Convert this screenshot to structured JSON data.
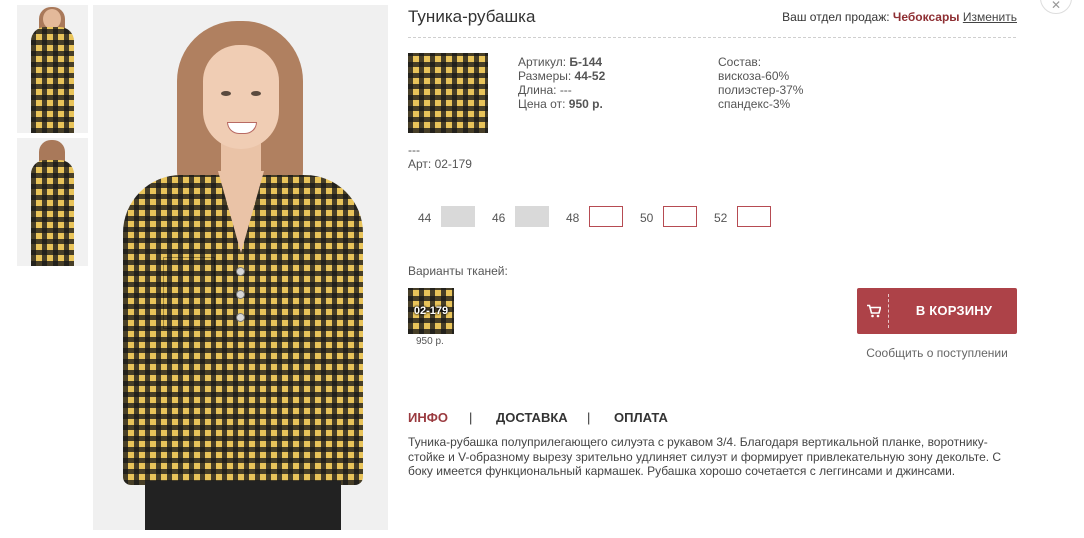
{
  "product": {
    "title": "Туника-рубашка",
    "fields": [
      {
        "label": "Артикул:",
        "value": "Б-144"
      },
      {
        "label": "Размеры:",
        "value": "44-52"
      },
      {
        "label": "Длина:",
        "value": "---"
      },
      {
        "label": "Цена от:",
        "value": "950 р."
      }
    ],
    "composition_title": "Состав:",
    "composition": [
      "вискоза-60%",
      "полиэстер-37%",
      "спандекс-3%"
    ],
    "dash": "---",
    "art_line": "Арт: 02-179"
  },
  "region": {
    "label": "Ваш отдел продаж:",
    "city": "Чебоксары",
    "change": "Изменить"
  },
  "sizes": [
    {
      "label": "44",
      "available": false
    },
    {
      "label": "46",
      "available": false
    },
    {
      "label": "48",
      "available": true
    },
    {
      "label": "50",
      "available": true
    },
    {
      "label": "52",
      "available": true
    }
  ],
  "variants": {
    "title": "Варианты тканей:",
    "items": [
      {
        "code": "02-179",
        "price": "950 р."
      }
    ]
  },
  "actions": {
    "cart_label": "В КОРЗИНУ",
    "notify_label": "Сообщить о поступлении"
  },
  "tabs": [
    {
      "label": "ИНФО",
      "active": true
    },
    {
      "label": "ДОСТАВКА",
      "active": false
    },
    {
      "label": "ОПЛАТА",
      "active": false
    }
  ],
  "tab_separator": "|",
  "description": "Туника-рубашка полуприлегающего силуэта с рукавом 3/4. Благодаря вертикальной планке, воротнику-стойке и V-образному вырезу зрительно удлиняет силуэт и формирует привлекательную зону декольте. С боку имеется функциональный кармашек. Рубашка хорошо сочетается с леггинсами и джинсами.",
  "colors": {
    "accent": "#ad4248",
    "active_tab": "#9a3a3f",
    "city": "#8e2f33",
    "fabric_yellow": "#e9c45a",
    "fabric_dark": "#1e1e1e"
  },
  "icons": {
    "cart": "shopping-cart-icon",
    "close": "close-icon"
  }
}
